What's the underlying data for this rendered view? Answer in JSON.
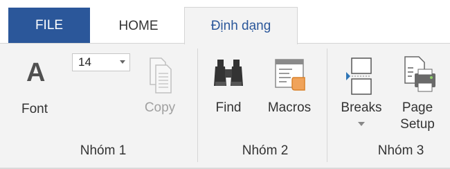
{
  "tabs": [
    {
      "label": "FILE",
      "state": "file"
    },
    {
      "label": "HOME",
      "state": "normal"
    },
    {
      "label": "Định dạng",
      "state": "active"
    }
  ],
  "groups": [
    {
      "label": "Nhóm 1",
      "font_button": {
        "label": "Font",
        "icon": "font-icon",
        "glyph": "A"
      },
      "font_size": {
        "value": "14"
      },
      "copy_button": {
        "label": "Copy",
        "icon": "copy-icon",
        "disabled": true
      }
    },
    {
      "label": "Nhóm 2",
      "find_button": {
        "label": "Find",
        "icon": "binoculars-icon"
      },
      "macros_button": {
        "label": "Macros",
        "icon": "macros-icon"
      }
    },
    {
      "label": "Nhóm 3",
      "breaks_button": {
        "label": "Breaks",
        "icon": "breaks-icon"
      },
      "page_setup_button": {
        "label": "Page\nSetup",
        "label_line1": "Page",
        "label_line2": "Setup",
        "icon": "page-setup-icon"
      }
    }
  ],
  "colors": {
    "file_tab": "#2b579a",
    "active_tab_text": "#2b579a",
    "ribbon_bg": "#f3f3f3",
    "disabled_text": "#a0a0a0"
  }
}
